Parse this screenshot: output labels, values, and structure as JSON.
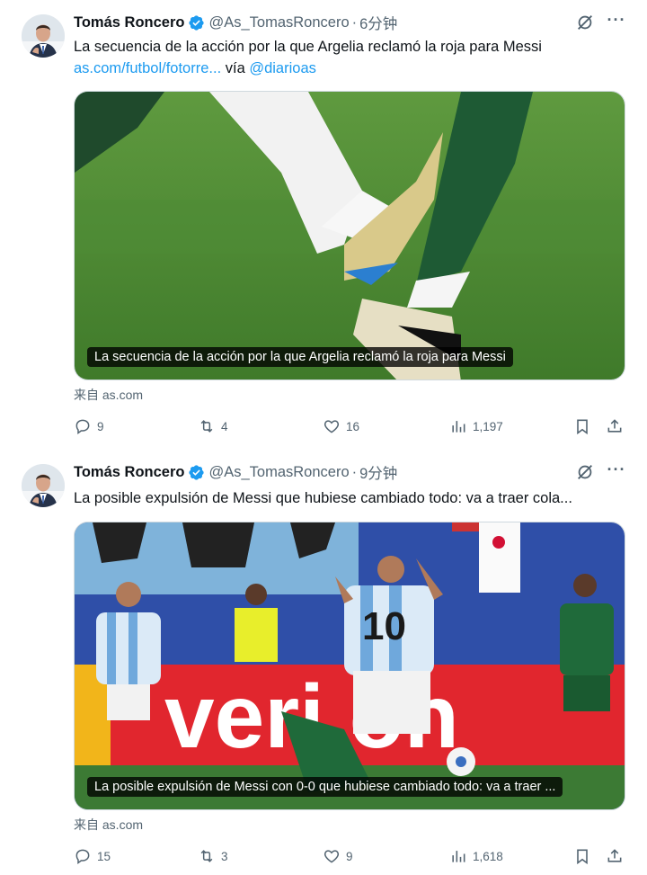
{
  "tweets": [
    {
      "author_name": "Tomás Roncero",
      "handle": "@As_TomasRoncero",
      "time": "6分钟",
      "text_line1": "La secuencia de la acción por la que Argelia reclamó la roja para Messi",
      "link_text": "as.com/futbol/fotorre...",
      "via_text": " vía ",
      "via_handle": "@diarioas",
      "media_caption": "La secuencia de la acción por la que Argelia reclamó la roja para Messi",
      "source": "来自 as.com",
      "replies": "9",
      "reposts": "4",
      "likes": "16",
      "views": "1,197"
    },
    {
      "author_name": "Tomás Roncero",
      "handle": "@As_TomasRoncero",
      "time": "9分钟",
      "text_line1": "La posible expulsión de Messi que hubiese cambiado todo: va a traer cola...",
      "media_caption": "La posible expulsión de Messi con 0-0 que hubiese cambiado todo: va a traer ...",
      "source": "来自 as.com",
      "replies": "15",
      "reposts": "3",
      "likes": "9",
      "views": "1,618"
    }
  ],
  "separator_dot": "·",
  "colors": {
    "link": "#1d9bf0",
    "verified": "#1d9bf0",
    "secondary_text": "#536471",
    "border": "#cfd9de"
  },
  "icons": [
    "verified-badge-icon",
    "grok-icon",
    "more-icon",
    "reply-icon",
    "repost-icon",
    "like-icon",
    "views-icon",
    "bookmark-icon",
    "share-icon"
  ]
}
